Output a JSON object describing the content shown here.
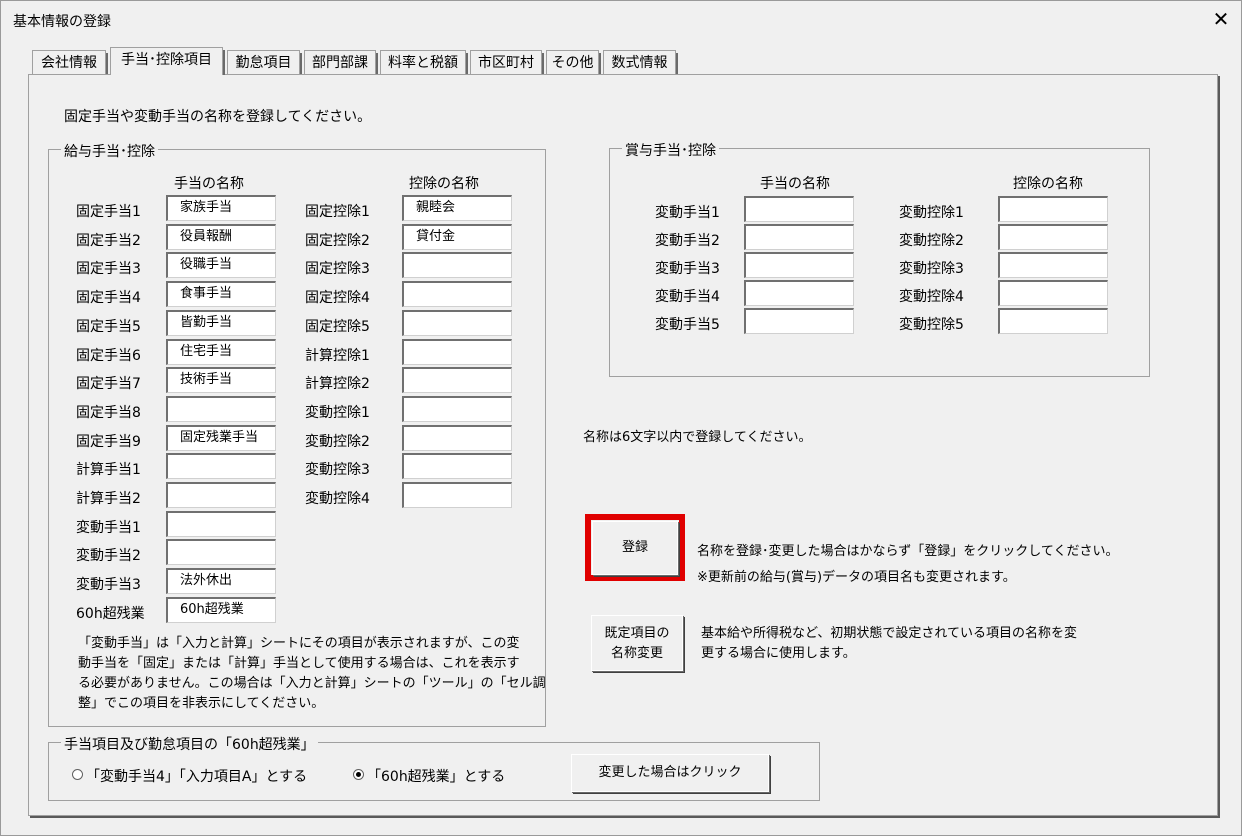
{
  "window": {
    "title": "基本情報の登録",
    "close_glyph": "✕"
  },
  "tabs": [
    "会社情報",
    "手当･控除項目",
    "勤怠項目",
    "部門部課",
    "料率と税額",
    "市区町村",
    "その他",
    "数式情報"
  ],
  "instruction": "固定手当や変動手当の名称を登録してください。",
  "salary": {
    "legend": "給与手当･控除",
    "allowance_header": "手当の名称",
    "deduction_header": "控除の名称",
    "allowances": [
      {
        "label": "固定手当1",
        "value": "家族手当"
      },
      {
        "label": "固定手当2",
        "value": "役員報酬"
      },
      {
        "label": "固定手当3",
        "value": "役職手当"
      },
      {
        "label": "固定手当4",
        "value": "食事手当"
      },
      {
        "label": "固定手当5",
        "value": "皆勤手当"
      },
      {
        "label": "固定手当6",
        "value": "住宅手当"
      },
      {
        "label": "固定手当7",
        "value": "技術手当"
      },
      {
        "label": "固定手当8",
        "value": ""
      },
      {
        "label": "固定手当9",
        "value": "固定残業手当"
      },
      {
        "label": "計算手当1",
        "value": ""
      },
      {
        "label": "計算手当2",
        "value": ""
      },
      {
        "label": "変動手当1",
        "value": ""
      },
      {
        "label": "変動手当2",
        "value": ""
      },
      {
        "label": "変動手当3",
        "value": "法外休出"
      },
      {
        "label": "60h超残業",
        "value": "60h超残業"
      }
    ],
    "deductions": [
      {
        "label": "固定控除1",
        "value": "親睦会"
      },
      {
        "label": "固定控除2",
        "value": "貸付金"
      },
      {
        "label": "固定控除3",
        "value": ""
      },
      {
        "label": "固定控除4",
        "value": ""
      },
      {
        "label": "固定控除5",
        "value": ""
      },
      {
        "label": "計算控除1",
        "value": ""
      },
      {
        "label": "計算控除2",
        "value": ""
      },
      {
        "label": "変動控除1",
        "value": ""
      },
      {
        "label": "変動控除2",
        "value": ""
      },
      {
        "label": "変動控除3",
        "value": ""
      },
      {
        "label": "変動控除4",
        "value": ""
      }
    ],
    "note_lines": [
      "「変動手当」は「入力と計算」シートにその項目が表示されますが、この変",
      "動手当を「固定」または「計算」手当として使用する場合は、これを表示す",
      "る必要がありません。この場合は「入力と計算」シートの「ツール」の「セル調",
      "整」でこの項目を非表示にしてください。"
    ]
  },
  "bonus": {
    "legend": "賞与手当･控除",
    "allowance_header": "手当の名称",
    "deduction_header": "控除の名称",
    "allowances": [
      {
        "label": "変動手当1",
        "value": ""
      },
      {
        "label": "変動手当2",
        "value": ""
      },
      {
        "label": "変動手当3",
        "value": ""
      },
      {
        "label": "変動手当4",
        "value": ""
      },
      {
        "label": "変動手当5",
        "value": ""
      }
    ],
    "deductions": [
      {
        "label": "変動控除1",
        "value": ""
      },
      {
        "label": "変動控除2",
        "value": ""
      },
      {
        "label": "変動控除3",
        "value": ""
      },
      {
        "label": "変動控除4",
        "value": ""
      },
      {
        "label": "変動控除5",
        "value": ""
      }
    ]
  },
  "length_note": "名称は6文字以内で登録してください。",
  "register": {
    "button_label": "登録",
    "highlight_color": "#e00000",
    "note_line1": "名称を登録･変更した場合はかならず「登録」をクリックしてください。",
    "note_line2": "※更新前の給与(賞与)データの項目名も変更されます。"
  },
  "rename": {
    "button_line1": "既定項目の",
    "button_line2": "名称変更",
    "note_line1": "基本給や所得税など、初期状態で設定されている項目の名称を変",
    "note_line2": "更する場合に使用します。"
  },
  "overtime": {
    "legend": "手当項目及び勤怠項目の「60h超残業」",
    "option1": "「変動手当4」「入力項目A」とする",
    "option2": "「60h超残業」とする",
    "selected": 2,
    "apply_button": "変更した場合はクリック"
  }
}
